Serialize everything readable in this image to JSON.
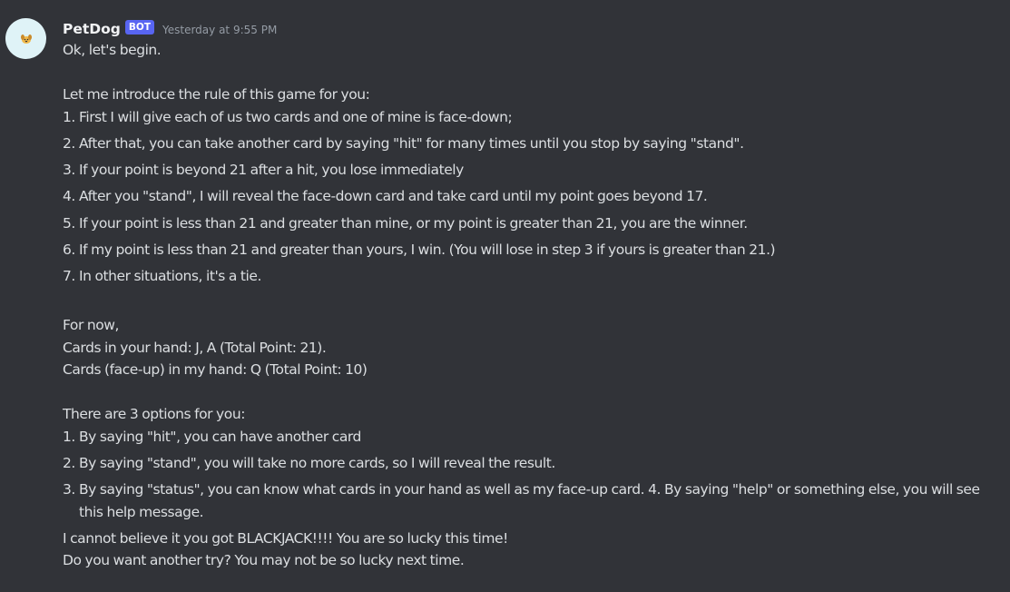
{
  "message": {
    "username": "PetDog",
    "bot_tag": "BOT",
    "timestamp": "Yesterday at 9:55 PM",
    "avatar_icon": "dog-avatar-icon",
    "greeting": "Ok, let's begin.",
    "rules_intro": "Let me introduce the rule of this game for you:",
    "rules": [
      "First I will give each of us two cards and one of mine is face-down;",
      "After that, you can take another card by saying \"hit\" for many times until you stop by saying \"stand\".",
      "If your point is beyond 21 after a hit, you lose immediately",
      "After you \"stand\", I will reveal the face-down card and take card until my point goes beyond 17.",
      "If your point is less than 21 and greater than mine, or my point is greater than 21, you are the winner.",
      "If my point is less than 21 and greater than yours, I win. (You will lose in step 3 if yours is greater than 21.)",
      "In other situations, it's a tie."
    ],
    "status_intro": "For now,",
    "your_hand": "Cards in your hand: J, A (Total Point: 21).",
    "dealer_hand": "Cards (face-up) in my hand: Q (Total Point: 10)",
    "options_intro": "There are 3 options for you:",
    "options": [
      "By saying \"hit\", you can have another card",
      "By saying \"stand\", you will take no more cards, so I will reveal the result.",
      "By saying \"status\", you can know what cards in your hand as well as my face-up card. 4. By saying \"help\" or something else, you will see this help message."
    ],
    "result_line1": "I cannot believe it you got BLACKJACK!!!! You are so lucky this time!",
    "result_line2": "Do you want another try? You may not be so lucky next time."
  },
  "colors": {
    "background": "#313338",
    "text": "#dbdee1",
    "username": "#f2f3f5",
    "bot_tag": "#5865f2",
    "timestamp": "#949ba4",
    "avatar_bg": "#dff3f7"
  }
}
